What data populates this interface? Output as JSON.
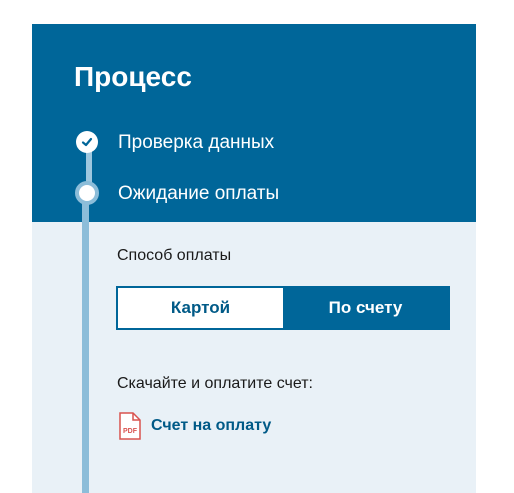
{
  "process": {
    "title": "Процесс",
    "steps": [
      {
        "label": "Проверка данных",
        "status": "done",
        "icon": "check-icon"
      },
      {
        "label": "Ожидание оплаты",
        "status": "current",
        "icon": "current-step-dot-icon"
      }
    ]
  },
  "payment": {
    "method_label": "Способ оплаты",
    "options": [
      {
        "label": "Картой",
        "selected": false
      },
      {
        "label": "По счету",
        "selected": true
      }
    ],
    "instruction": "Скачайте и оплатите счет:",
    "invoice_link": {
      "label": "Счет на оплату",
      "icon": "pdf-file-icon",
      "icon_text": "PDF"
    }
  },
  "colors": {
    "header_bg": "#006699",
    "panel_bg": "#e9f1f7",
    "track": "#8cbdd9",
    "accent_text": "#005a87",
    "pdf_red": "#d9534f"
  }
}
